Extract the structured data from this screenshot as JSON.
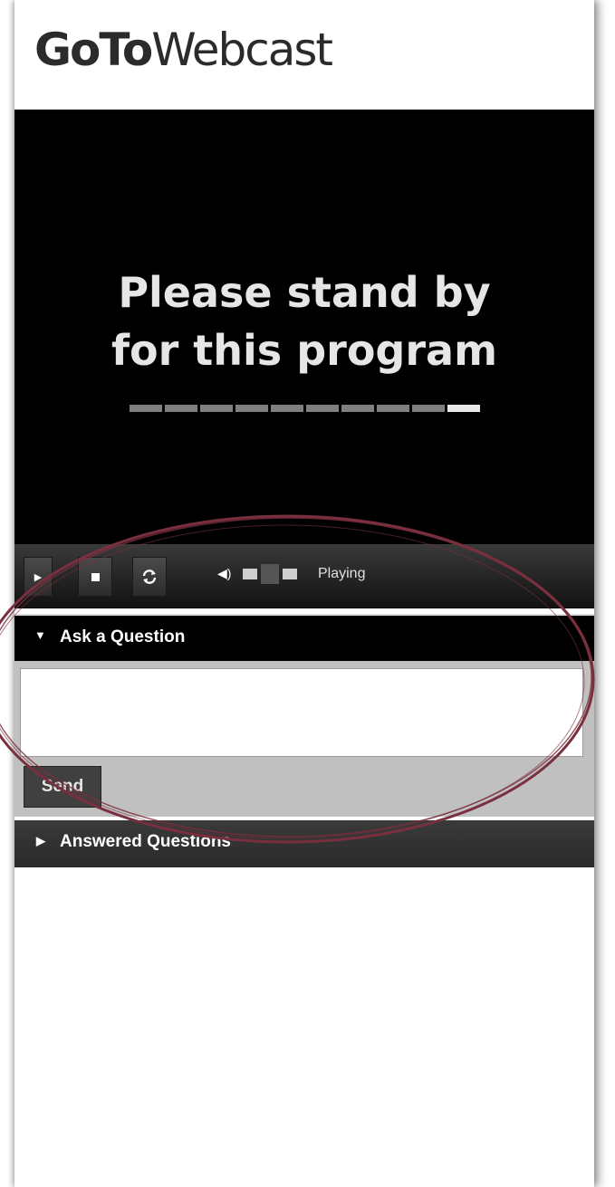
{
  "app": {
    "logo_bold": "GoTo",
    "logo_light": "Webcast"
  },
  "video": {
    "standby_line1": "Please stand by",
    "standby_line2": "for this program"
  },
  "player": {
    "play_icon": "play-icon",
    "stop_icon": "stop-icon",
    "refresh_icon": "refresh-icon",
    "volume_icon": "volume-icon",
    "status": "Playing"
  },
  "ask": {
    "header": "Ask a Question",
    "input_value": "",
    "send_label": "Send"
  },
  "answered": {
    "header": "Answered Questions"
  },
  "colors": {
    "annotation_ellipse": "#7a2f3f"
  }
}
